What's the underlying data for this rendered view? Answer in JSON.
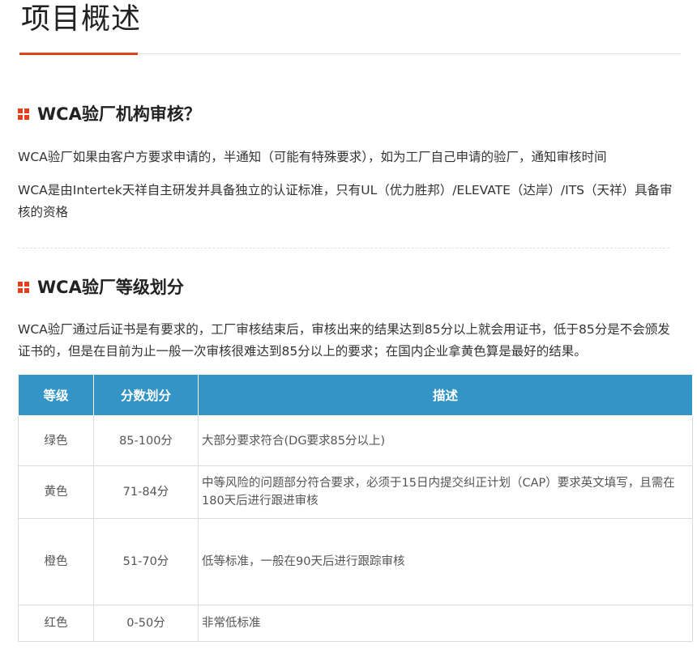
{
  "page": {
    "title": "项目概述"
  },
  "sections": [
    {
      "heading": "WCA验厂机构审核？",
      "paragraphs": [
        "WCA验厂如果由客户方要求申请的，半通知（可能有特殊要求），如为工厂自己申请的验厂，通知审核时间",
        "WCA是由Intertek天祥自主研发并具备独立的认证标准，只有UL（优力胜邦）/ELEVATE（达岸）/ITS（天祥）具备审核的资格"
      ]
    },
    {
      "heading": "WCA验厂等级划分",
      "paragraphs": [
        "WCA验厂通过后证书是有要求的，工厂审核结束后，审核出来的结果达到85分以上就会用证书，低于85分是不会颁发证书的，但是在目前为止一般一次审核很难达到85分以上的要求；在国内企业拿黄色算是最好的结果。"
      ]
    }
  ],
  "table": {
    "headers": [
      "等级",
      "分数划分",
      "描述"
    ],
    "rows": [
      {
        "grade": "绿色",
        "score": "85-100分",
        "desc": "大部分要求符合(DG要求85分以上)"
      },
      {
        "grade": "黄色",
        "score": "71-84分",
        "desc": "中等风险的问题部分符合要求，必须于15日内提交纠正计划（CAP）要求英文填写，且需在180天后进行跟进审核"
      },
      {
        "grade": "橙色",
        "score": "51-70分",
        "desc": "低等标准，一般在90天后进行跟踪审核"
      },
      {
        "grade": "红色",
        "score": "0-50分",
        "desc": "非常低标准"
      }
    ]
  },
  "colors": {
    "accent": "#e0411f",
    "table_header": "#3494c5"
  },
  "icons": {
    "heading_icon": "four-squares-icon"
  }
}
